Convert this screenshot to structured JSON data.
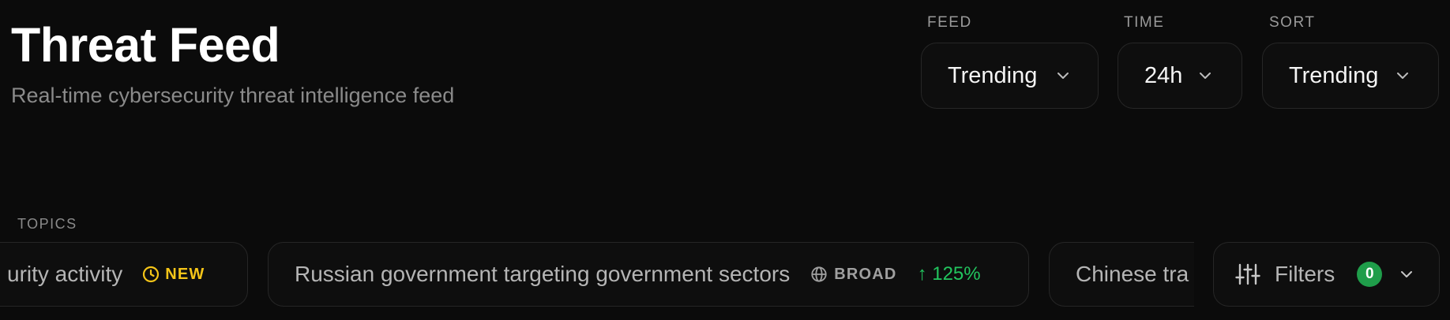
{
  "header": {
    "title": "Threat Feed",
    "subtitle": "Real-time cybersecurity threat intelligence feed"
  },
  "controls": {
    "feed": {
      "label": "FEED",
      "value": "Trending"
    },
    "time": {
      "label": "TIME",
      "value": "24h"
    },
    "sort": {
      "label": "SORT",
      "value": "Trending"
    }
  },
  "topics": {
    "label": "TOPICS",
    "items": [
      {
        "text": "urity activity",
        "badge": "NEW",
        "badge_icon": "clock-icon"
      },
      {
        "text": "Russian government targeting government sectors",
        "badge": "BROAD",
        "badge_icon": "globe-icon",
        "trend": "↑ 125%"
      },
      {
        "text": "Chinese tra"
      }
    ]
  },
  "filters": {
    "label": "Filters",
    "count": "0",
    "icon": "sliders-icon"
  },
  "colors": {
    "background": "#0b0b0b",
    "new_badge": "#f5c518",
    "trend_up": "#22c55e",
    "count_badge": "#1f9d4a"
  }
}
